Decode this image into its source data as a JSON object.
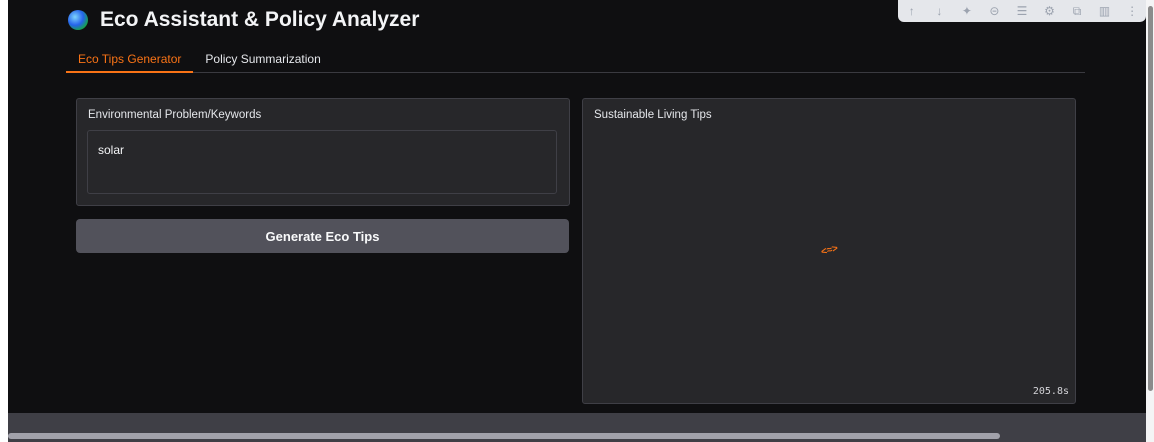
{
  "app": {
    "title": "Eco Assistant & Policy Analyzer"
  },
  "tabs": [
    {
      "label": "Eco Tips Generator",
      "active": true
    },
    {
      "label": "Policy Summarization",
      "active": false
    }
  ],
  "input_panel": {
    "label": "Environmental Problem/Keywords",
    "value": "solar"
  },
  "generate_button": {
    "label": "Generate Eco Tips"
  },
  "output_panel": {
    "label": "Sustainable Living Tips",
    "status": "loading",
    "elapsed": "205.8s"
  },
  "toolbar": {
    "icons": [
      "arrow-up-icon",
      "arrow-down-icon",
      "sparkle-icon",
      "link-icon",
      "comment-icon",
      "gear-icon",
      "mirror-icon",
      "trash-icon",
      "more-icon"
    ]
  },
  "colors": {
    "accent": "#f97316",
    "background": "#0f0f11",
    "panel": "#27272a",
    "button": "#52525b"
  }
}
